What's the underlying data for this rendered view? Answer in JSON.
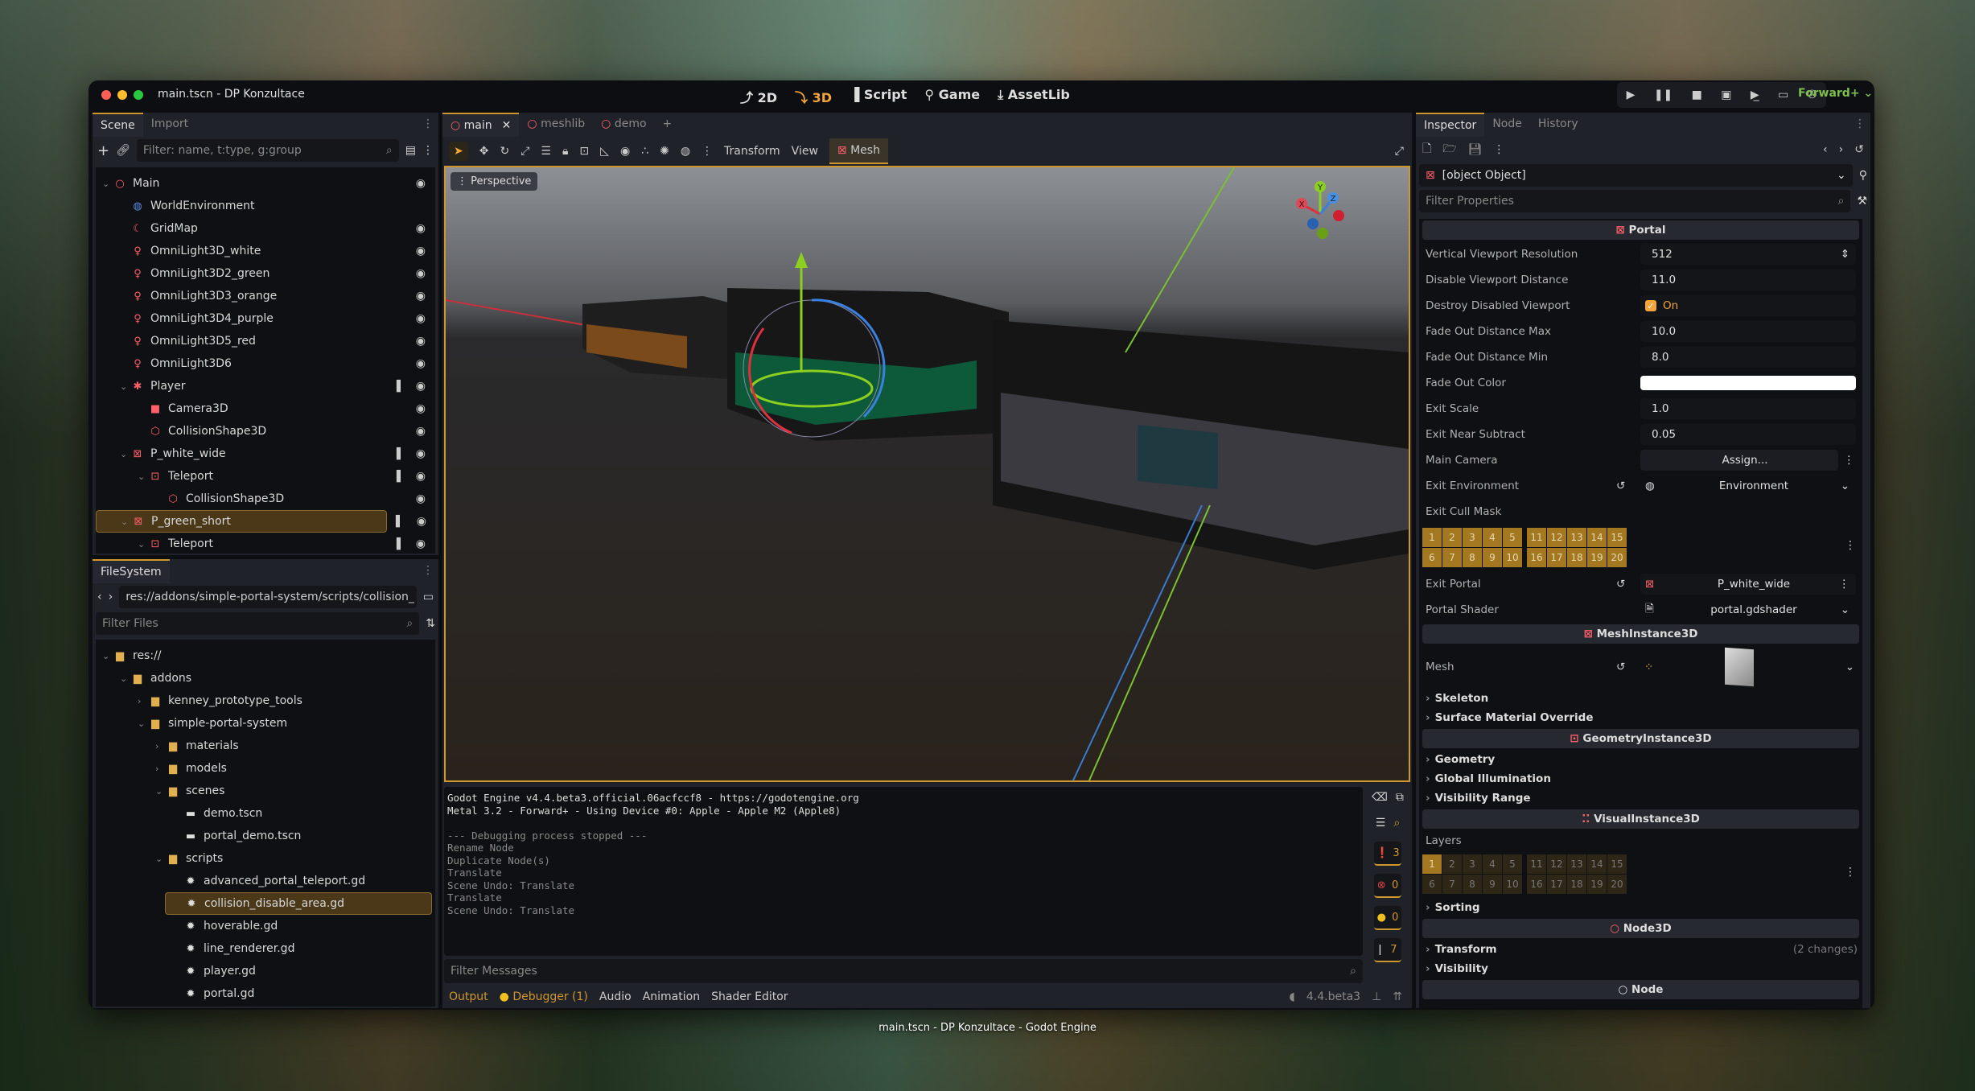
{
  "window": {
    "title": "main.tscn - DP Konzultace",
    "caption": "main.tscn - DP Konzultace - Godot Engine"
  },
  "modes": [
    {
      "label": "2D",
      "icon": "2d-icon"
    },
    {
      "label": "3D",
      "icon": "3d-icon",
      "active": true
    },
    {
      "label": "Script",
      "icon": "script-icon"
    },
    {
      "label": "Game",
      "icon": "game-icon"
    },
    {
      "label": "AssetLib",
      "icon": "assetlib-icon"
    }
  ],
  "renderer": "Forward+",
  "colors": {
    "accent": "#d0962e",
    "node3d": "#ff5f6a",
    "folder": "#e0b050",
    "renderer": "#7cbf4c"
  },
  "scene_dock": {
    "tabs": [
      "Scene",
      "Import"
    ],
    "filter_placeholder": "Filter: name, t:type, g:group",
    "tree": [
      {
        "label": "Main",
        "depth": 0,
        "icon": "node3d-icon",
        "eye": true
      },
      {
        "label": "WorldEnvironment",
        "depth": 1,
        "icon": "world-environment-icon"
      },
      {
        "label": "GridMap",
        "depth": 1,
        "icon": "gridmap-icon",
        "eye": true
      },
      {
        "label": "OmniLight3D_white",
        "depth": 1,
        "icon": "omnilight-icon",
        "eye": true
      },
      {
        "label": "OmniLight3D2_green",
        "depth": 1,
        "icon": "omnilight-icon",
        "eye": true
      },
      {
        "label": "OmniLight3D3_orange",
        "depth": 1,
        "icon": "omnilight-icon",
        "eye": true
      },
      {
        "label": "OmniLight3D4_purple",
        "depth": 1,
        "icon": "omnilight-icon",
        "eye": true
      },
      {
        "label": "OmniLight3D5_red",
        "depth": 1,
        "icon": "omnilight-icon",
        "eye": true
      },
      {
        "label": "OmniLight3D6",
        "depth": 1,
        "icon": "omnilight-icon",
        "eye": true
      },
      {
        "label": "Player",
        "depth": 1,
        "icon": "character-body-icon",
        "script": true,
        "eye": true,
        "expanded": true
      },
      {
        "label": "Camera3D",
        "depth": 2,
        "icon": "camera-icon",
        "eye": true
      },
      {
        "label": "CollisionShape3D",
        "depth": 2,
        "icon": "collision-shape-icon",
        "eye": true
      },
      {
        "label": "P_white_wide",
        "depth": 1,
        "icon": "mesh-instance-icon",
        "script": true,
        "eye": true,
        "expanded": true
      },
      {
        "label": "Teleport",
        "depth": 2,
        "icon": "area3d-icon",
        "script": true,
        "eye": true,
        "expanded": true
      },
      {
        "label": "CollisionShape3D",
        "depth": 3,
        "icon": "collision-shape-icon",
        "eye": true
      },
      {
        "label": "P_green_short",
        "depth": 1,
        "icon": "mesh-instance-icon",
        "script": true,
        "eye": true,
        "selected": true,
        "expanded": true
      },
      {
        "label": "Teleport",
        "depth": 2,
        "icon": "area3d-icon",
        "script": true,
        "eye": true,
        "expanded": true
      }
    ]
  },
  "filesystem": {
    "tab": "FileSystem",
    "path": "res://addons/simple-portal-system/scripts/collision_",
    "filter_placeholder": "Filter Files",
    "tree": [
      {
        "label": "res://",
        "depth": 0,
        "type": "folder",
        "arrow": "down"
      },
      {
        "label": "addons",
        "depth": 1,
        "type": "folder",
        "arrow": "down"
      },
      {
        "label": "kenney_prototype_tools",
        "depth": 2,
        "type": "folder",
        "arrow": "right"
      },
      {
        "label": "simple-portal-system",
        "depth": 2,
        "type": "folder",
        "arrow": "down"
      },
      {
        "label": "materials",
        "depth": 3,
        "type": "folder",
        "arrow": "right"
      },
      {
        "label": "models",
        "depth": 3,
        "type": "folder",
        "arrow": "right"
      },
      {
        "label": "scenes",
        "depth": 3,
        "type": "folder",
        "arrow": "down"
      },
      {
        "label": "demo.tscn",
        "depth": 4,
        "type": "scene"
      },
      {
        "label": "portal_demo.tscn",
        "depth": 4,
        "type": "scene"
      },
      {
        "label": "scripts",
        "depth": 3,
        "type": "folder",
        "arrow": "down"
      },
      {
        "label": "advanced_portal_teleport.gd",
        "depth": 4,
        "type": "script"
      },
      {
        "label": "collision_disable_area.gd",
        "depth": 4,
        "type": "script",
        "selected": true
      },
      {
        "label": "hoverable.gd",
        "depth": 4,
        "type": "script"
      },
      {
        "label": "line_renderer.gd",
        "depth": 4,
        "type": "script"
      },
      {
        "label": "player.gd",
        "depth": 4,
        "type": "script"
      },
      {
        "label": "portal.gd",
        "depth": 4,
        "type": "script"
      }
    ]
  },
  "editor": {
    "tabs": [
      "main",
      "meshlib",
      "demo"
    ],
    "active_tab": "main",
    "toolbar": {
      "transform": "Transform",
      "view": "View",
      "mesh": "Mesh"
    },
    "viewport": {
      "perspective": "Perspective",
      "gizmo": {
        "x": "X",
        "y": "Y",
        "z": "Z"
      }
    }
  },
  "output": {
    "lines": [
      {
        "text": "Godot Engine v4.4.beta3.official.06acfccf8 - https://godotengine.org",
        "bright": true
      },
      {
        "text": "Metal 3.2 - Forward+ - Using Device #0: Apple - Apple M2 (Apple8)",
        "bright": true
      },
      {
        "text": ""
      },
      {
        "text": "--- Debugging process stopped ---"
      },
      {
        "text": "Rename Node"
      },
      {
        "text": "Duplicate Node(s)"
      },
      {
        "text": "Translate"
      },
      {
        "text": "Scene Undo: Translate"
      },
      {
        "text": "Translate"
      },
      {
        "text": "Scene Undo: Translate"
      }
    ],
    "filter_placeholder": "Filter Messages",
    "counts": {
      "messages": "3",
      "errors": "0",
      "warnings": "0",
      "info": "7"
    }
  },
  "bottom_tabs": [
    "Output",
    "Debugger (1)",
    "Audio",
    "Animation",
    "Shader Editor"
  ],
  "version": "4.4.beta3",
  "inspector": {
    "tabs": [
      "Inspector",
      "Node",
      "History"
    ],
    "node": {
      "header": "Node"
    },
    "filter_placeholder": "Filter Properties",
    "portal": {
      "header": "Portal",
      "props": [
        {
          "label": "Vertical Viewport Resolution",
          "value": "512"
        },
        {
          "label": "Disable Viewport Distance",
          "value": "11.0"
        },
        {
          "label": "Destroy Disabled Viewport",
          "value": "On",
          "checkbox": true
        },
        {
          "label": "Fade Out Distance Max",
          "value": "10.0"
        },
        {
          "label": "Fade Out Distance Min",
          "value": "8.0"
        },
        {
          "label": "Fade Out Color",
          "color": "#ffffff"
        },
        {
          "label": "Exit Scale",
          "value": "1.0"
        },
        {
          "label": "Exit Near Subtract",
          "value": "0.05"
        }
      ],
      "main_camera": {
        "label": "Main Camera",
        "value": "Assign..."
      },
      "exit_environment": {
        "label": "Exit Environment",
        "value": "Environment"
      },
      "exit_cull_mask": {
        "label": "Exit Cull Mask",
        "enabled": [
          1,
          2,
          3,
          4,
          5,
          6,
          7,
          8,
          9,
          10,
          11,
          12,
          13,
          14,
          15,
          16,
          17,
          18,
          19,
          20
        ]
      },
      "exit_portal": {
        "label": "Exit Portal",
        "value": "P_white_wide"
      },
      "portal_shader": {
        "label": "Portal Shader",
        "value": "portal.gdshader"
      }
    },
    "mesh_instance": {
      "header": "MeshInstance3D",
      "mesh_label": "Mesh",
      "groups": [
        "Skeleton",
        "Surface Material Override"
      ]
    },
    "geometry_instance": {
      "header": "GeometryInstance3D",
      "groups": [
        "Geometry",
        "Global Illumination",
        "Visibility Range"
      ]
    },
    "visual_instance": {
      "header": "VisualInstance3D",
      "layers_label": "Layers",
      "enabled": [
        1
      ],
      "groups": [
        "Sorting"
      ]
    },
    "node3d": {
      "header": "Node3D",
      "groups": [
        {
          "label": "Transform",
          "note": "(2 changes)"
        },
        {
          "label": "Visibility"
        }
      ]
    }
  }
}
